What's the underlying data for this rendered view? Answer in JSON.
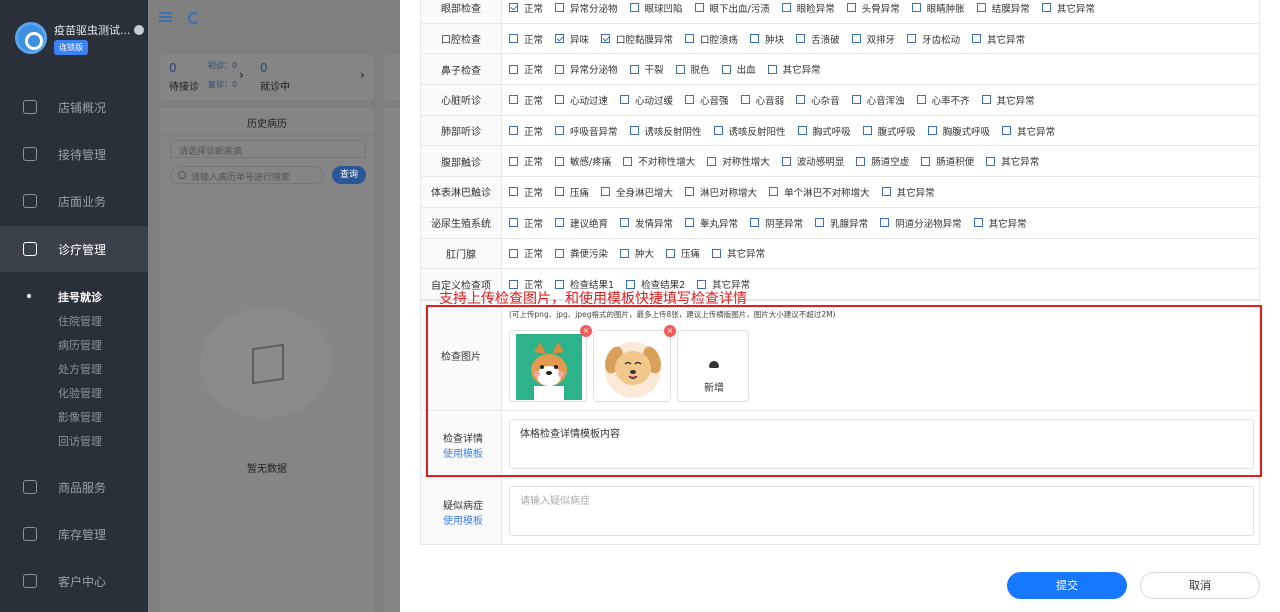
{
  "sidebar": {
    "app_title": "疫苗驱虫测试...",
    "badge": "连锁版",
    "nav": [
      {
        "label": "店铺概况",
        "icon": "monitor-icon"
      },
      {
        "label": "接待管理",
        "icon": "reception-icon"
      },
      {
        "label": "店面业务",
        "icon": "store-icon"
      },
      {
        "label": "诊疗管理",
        "icon": "medical-icon"
      },
      {
        "label": "商品服务",
        "icon": "goods-icon"
      },
      {
        "label": "库存管理",
        "icon": "inventory-icon"
      },
      {
        "label": "客户中心",
        "icon": "customer-icon"
      }
    ],
    "sub_items": [
      "挂号就诊",
      "住院管理",
      "病历管理",
      "处方管理",
      "化验管理",
      "影像管理",
      "回访管理"
    ]
  },
  "stats": {
    "waiting_num": "0",
    "waiting_label": "待接诊",
    "first_visit": "初诊：0",
    "return_visit": "复诊：0",
    "in_progress_num": "0",
    "in_progress_label": "就诊中"
  },
  "history": {
    "title": "历史病历",
    "select_placeholder": "请选择诊断疾病",
    "search_placeholder": "请输入病历单号进行搜索",
    "search_button": "查询",
    "empty_text": "暂无数据"
  },
  "exam_rows": [
    {
      "label": "眼部检查",
      "options": [
        {
          "text": "正常",
          "checked": true
        },
        {
          "text": "异常分泌物",
          "checked": false
        },
        {
          "text": "眼球凹陷",
          "checked": false
        },
        {
          "text": "眼下出血/污渍",
          "checked": false
        },
        {
          "text": "眼睑异常",
          "checked": false
        },
        {
          "text": "头骨异常",
          "checked": false
        },
        {
          "text": "眼睛肿胀",
          "checked": false
        },
        {
          "text": "结膜异常",
          "checked": false
        },
        {
          "text": "其它异常",
          "checked": false
        }
      ]
    },
    {
      "label": "口腔检查",
      "options": [
        {
          "text": "正常",
          "checked": false
        },
        {
          "text": "异味",
          "checked": true
        },
        {
          "text": "口腔黏膜异常",
          "checked": true
        },
        {
          "text": "口腔溃疡",
          "checked": false
        },
        {
          "text": "肿块",
          "checked": false
        },
        {
          "text": "舌溃破",
          "checked": false
        },
        {
          "text": "双排牙",
          "checked": false
        },
        {
          "text": "牙齿松动",
          "checked": false
        },
        {
          "text": "其它异常",
          "checked": false
        }
      ]
    },
    {
      "label": "鼻子检查",
      "options": [
        {
          "text": "正常",
          "checked": false
        },
        {
          "text": "异常分泌物",
          "checked": false
        },
        {
          "text": "干裂",
          "checked": false
        },
        {
          "text": "脱色",
          "checked": false
        },
        {
          "text": "出血",
          "checked": false
        },
        {
          "text": "其它异常",
          "checked": false
        }
      ]
    },
    {
      "label": "心脏听诊",
      "options": [
        {
          "text": "正常",
          "checked": false
        },
        {
          "text": "心动过速",
          "checked": false
        },
        {
          "text": "心动过缓",
          "checked": false
        },
        {
          "text": "心音强",
          "checked": false
        },
        {
          "text": "心音弱",
          "checked": false
        },
        {
          "text": "心杂音",
          "checked": false
        },
        {
          "text": "心音浑浊",
          "checked": false
        },
        {
          "text": "心率不齐",
          "checked": false
        },
        {
          "text": "其它异常",
          "checked": false
        }
      ]
    },
    {
      "label": "肺部听诊",
      "options": [
        {
          "text": "正常",
          "checked": false
        },
        {
          "text": "呼吸音异常",
          "checked": false
        },
        {
          "text": "诱咳反射阴性",
          "checked": false
        },
        {
          "text": "诱咳反射阳性",
          "checked": false
        },
        {
          "text": "胸式呼吸",
          "checked": false
        },
        {
          "text": "腹式呼吸",
          "checked": false
        },
        {
          "text": "胸腹式呼吸",
          "checked": false
        },
        {
          "text": "其它异常",
          "checked": false
        }
      ]
    },
    {
      "label": "腹部触诊",
      "options": [
        {
          "text": "正常",
          "checked": false
        },
        {
          "text": "敏感/疼痛",
          "checked": false
        },
        {
          "text": "不对称性增大",
          "checked": false
        },
        {
          "text": "对称性增大",
          "checked": false
        },
        {
          "text": "波动感明显",
          "checked": false
        },
        {
          "text": "肠道空虚",
          "checked": false
        },
        {
          "text": "肠道积便",
          "checked": false
        },
        {
          "text": "其它异常",
          "checked": false
        }
      ]
    },
    {
      "label": "体表淋巴触诊",
      "options": [
        {
          "text": "正常",
          "checked": false
        },
        {
          "text": "压痛",
          "checked": false
        },
        {
          "text": "全身淋巴增大",
          "checked": false
        },
        {
          "text": "淋巴对称增大",
          "checked": false
        },
        {
          "text": "单个淋巴不对称增大",
          "checked": false
        },
        {
          "text": "其它异常",
          "checked": false
        }
      ]
    },
    {
      "label": "泌尿生殖系统",
      "options": [
        {
          "text": "正常",
          "checked": false
        },
        {
          "text": "建议绝育",
          "checked": false
        },
        {
          "text": "发情异常",
          "checked": false
        },
        {
          "text": "睾丸异常",
          "checked": false
        },
        {
          "text": "阴茎异常",
          "checked": false
        },
        {
          "text": "乳腺异常",
          "checked": false
        },
        {
          "text": "阴道分泌物异常",
          "checked": false
        },
        {
          "text": "其它异常",
          "checked": false
        }
      ]
    },
    {
      "label": "肛门腺",
      "options": [
        {
          "text": "正常",
          "checked": false
        },
        {
          "text": "粪便污染",
          "checked": false
        },
        {
          "text": "肿大",
          "checked": false
        },
        {
          "text": "压痛",
          "checked": false
        },
        {
          "text": "其它异常",
          "checked": false
        }
      ]
    },
    {
      "label": "自定义检查项",
      "options": [
        {
          "text": "正常",
          "checked": false
        },
        {
          "text": "检查结果1",
          "checked": false
        },
        {
          "text": "检查结果2",
          "checked": false
        },
        {
          "text": "其它异常",
          "checked": false
        }
      ]
    }
  ],
  "annotation": "支持上传检查图片，和使用模板快捷填写检查详情",
  "images": {
    "label": "检查图片",
    "hint": "(可上传png、jpg、jpeg格式的图片，最多上传8张，建议上传横版图片，图片大小建议不超过2M)",
    "add_label": "新增"
  },
  "detail": {
    "label": "检查详情",
    "template_link": "使用模板",
    "value": "体格检查详情模板内容"
  },
  "diagnosis": {
    "label": "疑似病症",
    "template_link": "使用模板",
    "placeholder": "请输入疑似病症"
  },
  "actions": {
    "submit": "提交",
    "cancel": "取消"
  },
  "colors": {
    "primary": "#1677ff",
    "annotation": "#e02020",
    "sidebar_bg": "#2a3039"
  }
}
